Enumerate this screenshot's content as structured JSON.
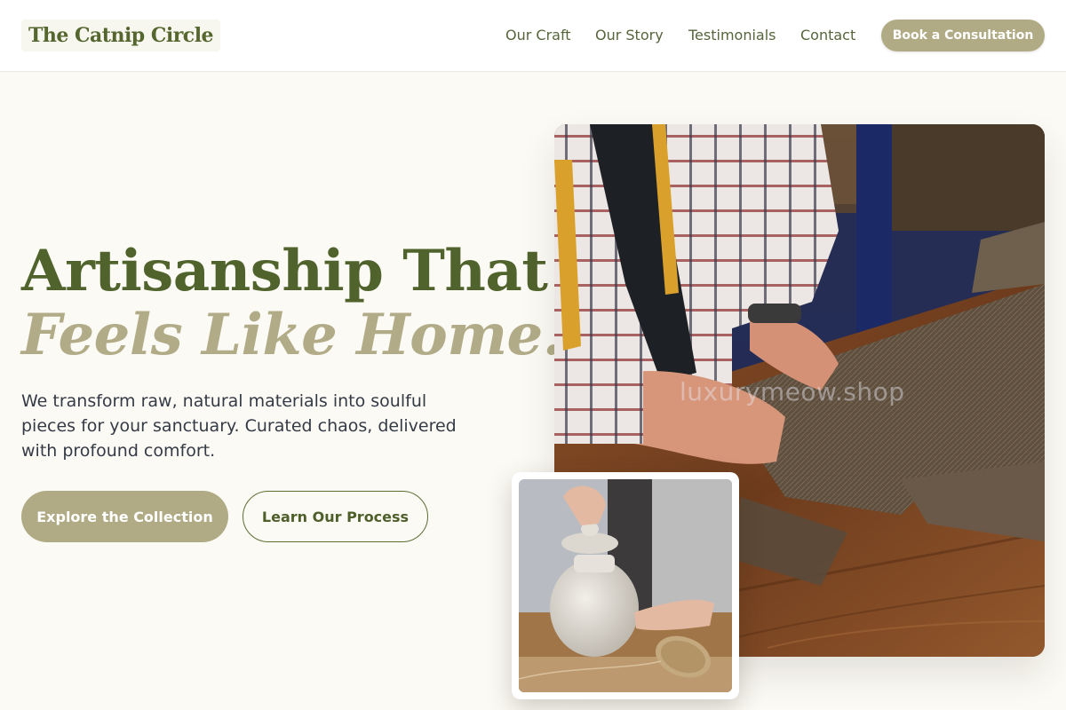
{
  "brand": {
    "name": "The Catnip Circle"
  },
  "nav": {
    "items": [
      {
        "label": "Our Craft"
      },
      {
        "label": "Our Story"
      },
      {
        "label": "Testimonials"
      },
      {
        "label": "Contact"
      }
    ],
    "cta_label": "Book a Consultation"
  },
  "hero": {
    "headline_line1": "Artisanship That",
    "headline_line2": "Feels Like Home.",
    "description": "We transform raw, natural materials into soulful pieces for your sanctuary. Curated chaos, delivered with profound comfort.",
    "primary_button": "Explore the Collection",
    "secondary_button": "Learn Our Process"
  },
  "images": {
    "main_photo_watermark": "luxurymeow.shop",
    "main_photo_subject": "tailor-hands-cutting-tweed-fabric",
    "inset_photo_subject": "hands-opening-ceramic-jar-with-twine"
  },
  "colors": {
    "brand_green": "#51632d",
    "accent_khaki": "#b0ab84",
    "background": "#fbfaf4",
    "text": "#353b46"
  }
}
